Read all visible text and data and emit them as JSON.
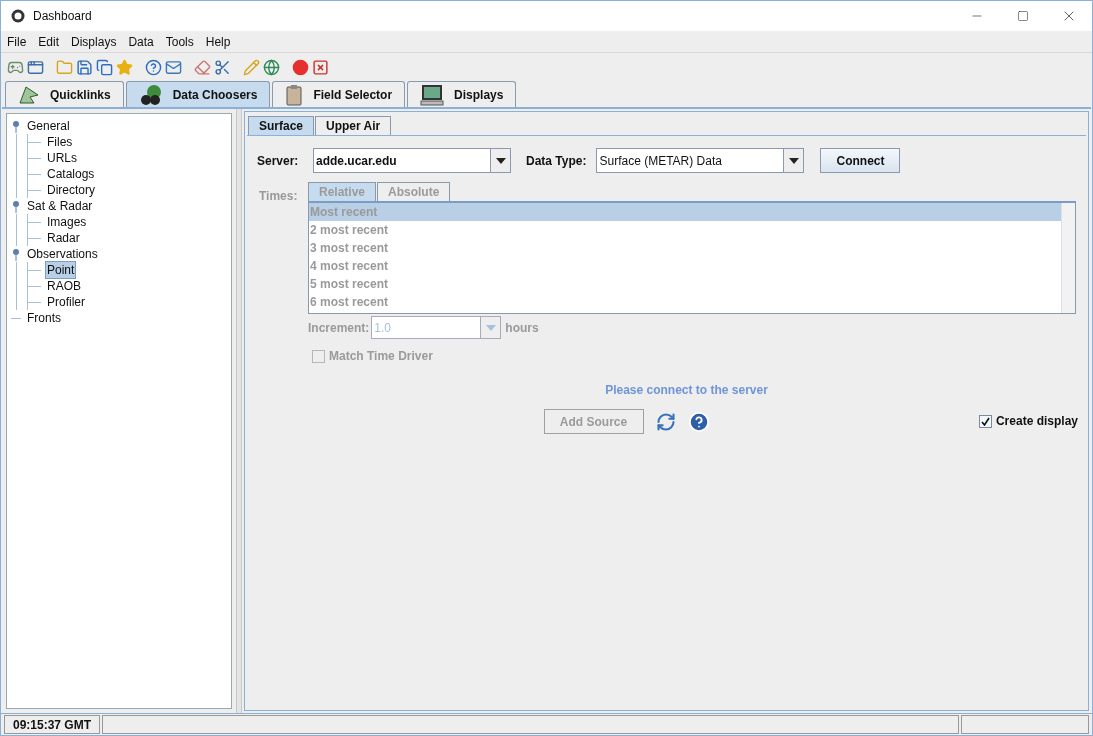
{
  "window": {
    "title": "Dashboard"
  },
  "menu": [
    "File",
    "Edit",
    "Displays",
    "Data",
    "Tools",
    "Help"
  ],
  "tabs": [
    {
      "label": "Quicklinks",
      "selected": false,
      "kind": "links"
    },
    {
      "label": "Data Choosers",
      "selected": true,
      "kind": "choosers"
    },
    {
      "label": "Field Selector",
      "selected": false,
      "kind": "fields"
    },
    {
      "label": "Displays",
      "selected": false,
      "kind": "displays"
    }
  ],
  "tree": [
    {
      "label": "General",
      "selected": false,
      "children": [
        {
          "label": "Files",
          "selected": false
        },
        {
          "label": "URLs",
          "selected": false
        },
        {
          "label": "Catalogs",
          "selected": false
        },
        {
          "label": "Directory",
          "selected": false
        }
      ]
    },
    {
      "label": "Sat & Radar",
      "selected": false,
      "children": [
        {
          "label": "Images",
          "selected": false
        },
        {
          "label": "Radar",
          "selected": false
        }
      ]
    },
    {
      "label": "Observations",
      "selected": false,
      "children": [
        {
          "label": "Point",
          "selected": true
        },
        {
          "label": "RAOB",
          "selected": false
        },
        {
          "label": "Profiler",
          "selected": false
        }
      ]
    },
    {
      "label": "Fronts",
      "selected": false
    }
  ],
  "subtabs": [
    {
      "label": "Surface",
      "selected": true
    },
    {
      "label": "Upper Air",
      "selected": false
    }
  ],
  "server": {
    "label": "Server:",
    "value": "adde.ucar.edu"
  },
  "data_type": {
    "label": "Data Type:",
    "value": "Surface (METAR) Data"
  },
  "connect_button": "Connect",
  "times": {
    "label": "Times:",
    "disabled": true,
    "tabs": [
      {
        "label": "Relative",
        "selected": true
      },
      {
        "label": "Absolute",
        "selected": false
      }
    ],
    "items": [
      {
        "label": "Most recent",
        "selected": true
      },
      {
        "label": "2 most recent",
        "selected": false
      },
      {
        "label": "3 most recent",
        "selected": false
      },
      {
        "label": "4 most recent",
        "selected": false
      },
      {
        "label": "5 most recent",
        "selected": false
      },
      {
        "label": "6 most recent",
        "selected": false
      }
    ],
    "increment": {
      "label": "Increment:",
      "value": "1.0",
      "unit": "hours"
    },
    "match_time_driver": {
      "label": "Match Time Driver",
      "checked": false
    }
  },
  "message": "Please connect to the server",
  "add_source": {
    "label": "Add Source",
    "disabled": true
  },
  "create_display": {
    "label": "Create display",
    "checked": true
  },
  "status_bar": {
    "time": "09:15:37 GMT"
  }
}
